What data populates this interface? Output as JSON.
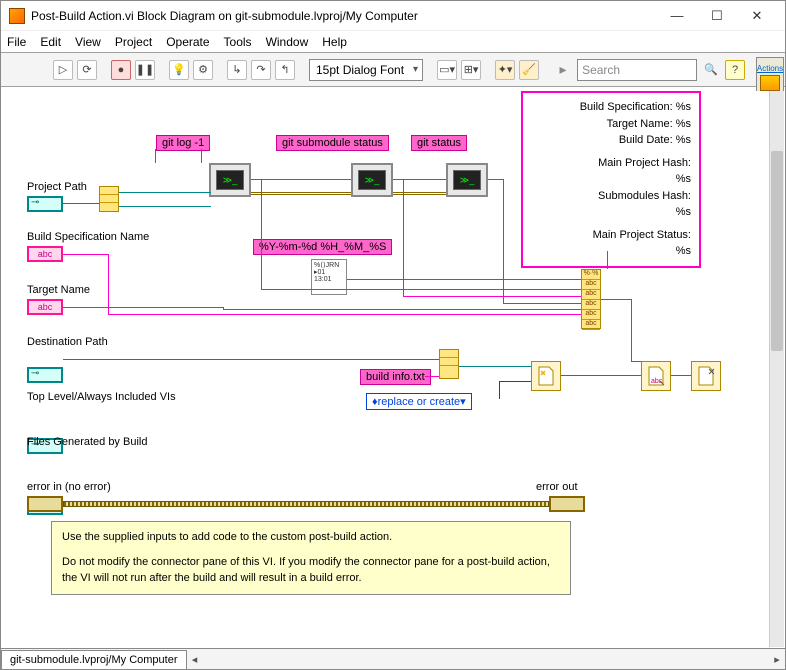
{
  "window": {
    "title": "Post-Build Action.vi Block Diagram on git-submodule.lvproj/My Computer"
  },
  "menu": {
    "file": "File",
    "edit": "Edit",
    "view": "View",
    "project": "Project",
    "operate": "Operate",
    "tools": "Tools",
    "window": "Window",
    "help": "Help"
  },
  "toolbar": {
    "font": "15pt Dialog Font",
    "search_placeholder": "Search"
  },
  "side_panel": {
    "label": "Actions"
  },
  "terminals": {
    "project_path": "Project Path",
    "build_spec": "Build Specification Name",
    "target_name": "Target Name",
    "dest_path": "Destination Path",
    "top_vis": "Top Level/Always Included VIs",
    "files_gen": "Files Generated by Build",
    "error_in": "error in (no error)",
    "error_out": "error out",
    "abc": "abc"
  },
  "cmds": {
    "git_log": "git log -1",
    "git_sub": "git submodule status",
    "git_status": "git status",
    "timefmt": "%Y-%m-%d %H_%M_%S",
    "build_info": "build info.txt",
    "replace": "replace or create",
    "prompt": "≫_"
  },
  "format_box": {
    "l1": "Build Specification: %s",
    "l2": "Target Name: %s",
    "l3": "Build Date: %s",
    "l4": "Main Project Hash:",
    "l5": "%s",
    "l6": "Submodules Hash:",
    "l7": "%s",
    "l8": "Main Project Status:",
    "l9": "%s"
  },
  "note": {
    "p1": "Use the supplied inputs to add code to the custom post-build action.",
    "p2": "Do not modify the connector pane of this VI.  If you modify the connector pane for a post-build action, the VI will not run after the build and will result in a build error."
  },
  "status": {
    "path": "git-submodule.lvproj/My Computer"
  }
}
